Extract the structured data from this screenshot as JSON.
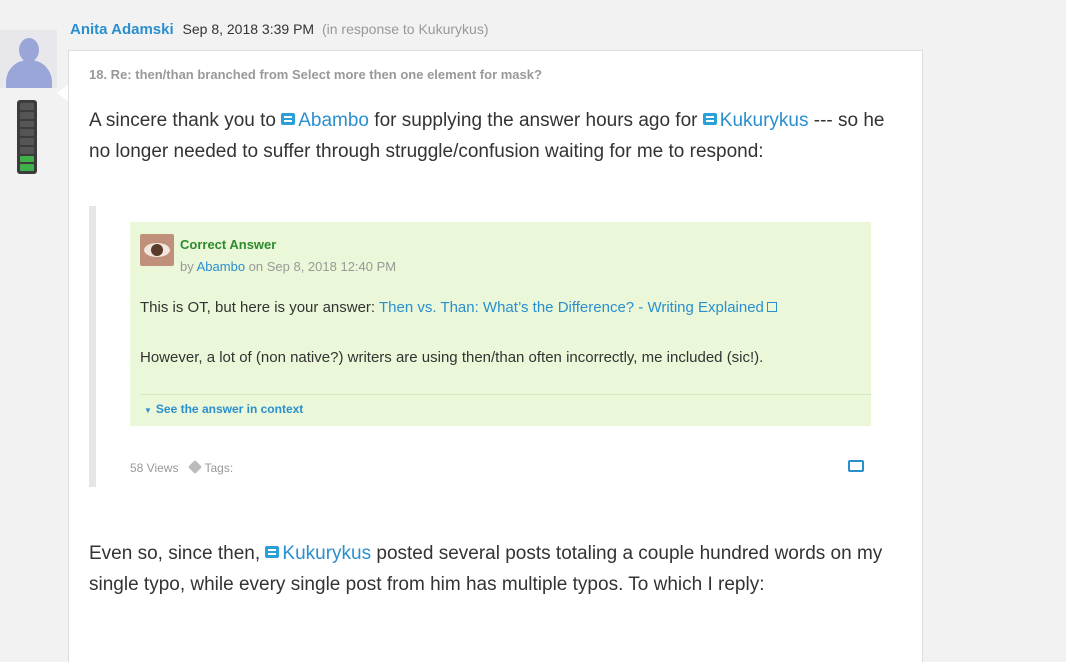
{
  "post": {
    "author": "Anita Adamski",
    "date": "Sep 8, 2018 3:39 PM",
    "in_response": "(in response to Kukurykus)",
    "title": "18. Re: then/than branched from Select more then one element for mask?",
    "para1": {
      "pre": "A sincere thank you to ",
      "mention1": "Abambo",
      "mid": "  for supplying the answer hours ago for ",
      "mention2": "Kukurykus",
      "post": "  --- so he no longer needed to suffer through  struggle/confusion waiting for me to respond:"
    },
    "para2": {
      "pre": "Even so, since then, ",
      "mention": "Kukurykus",
      "post": " posted several posts totaling a couple hundred words on my single typo, while every single post from him has multiple typos.  To which I reply:"
    }
  },
  "quote": {
    "label": "Correct Answer",
    "by_prefix": "by ",
    "by_author": "Abambo",
    "by_date": " on Sep 8, 2018 12:40 PM",
    "line1_pre": "This is OT, but here is your answer: ",
    "line1_link": "Then vs. Than: What’s the Difference? - Writing Explained",
    "line2": "However, a lot of (non native?) writers are using then/than often incorrectly, me included (sic!).",
    "context_link": "See the answer in context",
    "views": "58 Views",
    "tags": "Tags:"
  },
  "rank": {
    "segments": 8,
    "filled": 2,
    "fill_color": "#3fb04a"
  },
  "colors": {
    "link": "#2a8fcf",
    "answer_bg": "#eaf7d8",
    "correct": "#2e8b2e"
  }
}
